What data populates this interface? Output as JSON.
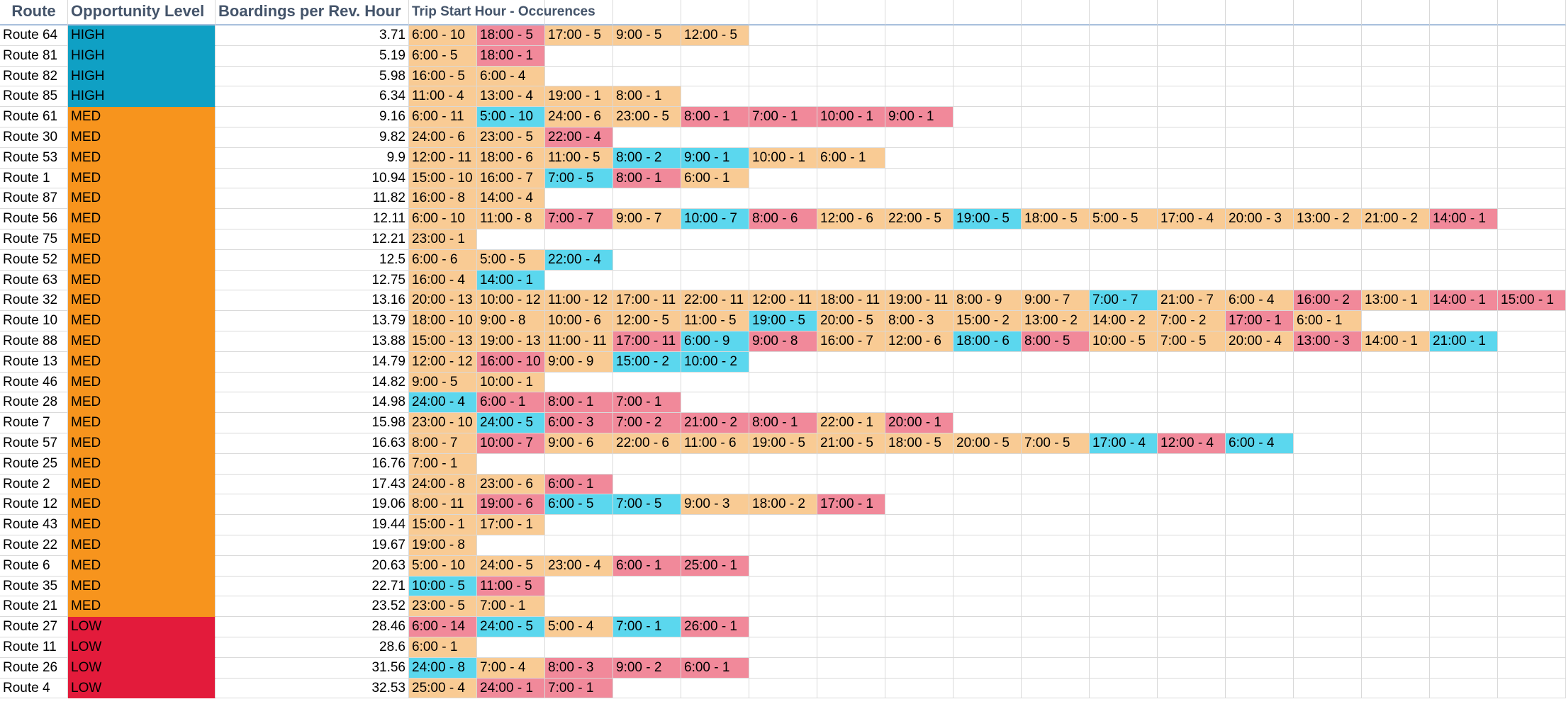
{
  "colors": {
    "peach": "#f9cb94",
    "pink": "#f1899a",
    "cyan": "#5bd7ee",
    "HIGH": "#0fa0c4",
    "MED": "#f7941d",
    "LOW": "#e31b3b",
    "header_text": "#44546a"
  },
  "headers": {
    "route": "Route",
    "level": "Opportunity Level",
    "boardings": "Boardings per Rev. Hour",
    "trips": "Trip Start Hour - Occurences"
  },
  "rows": [
    {
      "route": "Route 64",
      "level": "HIGH",
      "boardings": "3.71",
      "trips": [
        [
          "6:00 - 10",
          "peach"
        ],
        [
          "18:00 - 5",
          "pink"
        ],
        [
          "17:00 - 5",
          "peach"
        ],
        [
          "9:00 - 5",
          "peach"
        ],
        [
          "12:00 - 5",
          "peach"
        ]
      ]
    },
    {
      "route": "Route 81",
      "level": "HIGH",
      "boardings": "5.19",
      "trips": [
        [
          "6:00 - 5",
          "peach"
        ],
        [
          "18:00 - 1",
          "pink"
        ]
      ]
    },
    {
      "route": "Route 82",
      "level": "HIGH",
      "boardings": "5.98",
      "trips": [
        [
          "16:00 - 5",
          "peach"
        ],
        [
          "6:00 - 4",
          "peach"
        ]
      ]
    },
    {
      "route": "Route 85",
      "level": "HIGH",
      "boardings": "6.34",
      "trips": [
        [
          "11:00 - 4",
          "peach"
        ],
        [
          "13:00 - 4",
          "peach"
        ],
        [
          "19:00 - 1",
          "peach"
        ],
        [
          "8:00 - 1",
          "peach"
        ]
      ]
    },
    {
      "route": "Route 61",
      "level": "MED",
      "boardings": "9.16",
      "trips": [
        [
          "6:00 - 11",
          "peach"
        ],
        [
          "5:00 - 10",
          "cyan"
        ],
        [
          "24:00 - 6",
          "peach"
        ],
        [
          "23:00 - 5",
          "peach"
        ],
        [
          "8:00 - 1",
          "pink"
        ],
        [
          "7:00 - 1",
          "pink"
        ],
        [
          "10:00 - 1",
          "pink"
        ],
        [
          "9:00 - 1",
          "pink"
        ]
      ]
    },
    {
      "route": "Route 30",
      "level": "MED",
      "boardings": "9.82",
      "trips": [
        [
          "24:00 - 6",
          "peach"
        ],
        [
          "23:00 - 5",
          "peach"
        ],
        [
          "22:00 - 4",
          "pink"
        ]
      ]
    },
    {
      "route": "Route 53",
      "level": "MED",
      "boardings": "9.9",
      "trips": [
        [
          "12:00 - 11",
          "peach"
        ],
        [
          "18:00 - 6",
          "peach"
        ],
        [
          "11:00 - 5",
          "peach"
        ],
        [
          "8:00 - 2",
          "cyan"
        ],
        [
          "9:00 - 1",
          "cyan"
        ],
        [
          "10:00 - 1",
          "peach"
        ],
        [
          "6:00 - 1",
          "peach"
        ]
      ]
    },
    {
      "route": "Route 1",
      "level": "MED",
      "boardings": "10.94",
      "trips": [
        [
          "15:00 - 10",
          "peach"
        ],
        [
          "16:00 - 7",
          "peach"
        ],
        [
          "7:00 - 5",
          "cyan"
        ],
        [
          "8:00 - 1",
          "pink"
        ],
        [
          "6:00 - 1",
          "peach"
        ]
      ]
    },
    {
      "route": "Route 87",
      "level": "MED",
      "boardings": "11.82",
      "trips": [
        [
          "16:00 - 8",
          "peach"
        ],
        [
          "14:00 - 4",
          "peach"
        ]
      ]
    },
    {
      "route": "Route 56",
      "level": "MED",
      "boardings": "12.11",
      "trips": [
        [
          "6:00 - 10",
          "peach"
        ],
        [
          "11:00 - 8",
          "peach"
        ],
        [
          "7:00 - 7",
          "pink"
        ],
        [
          "9:00 - 7",
          "peach"
        ],
        [
          "10:00 - 7",
          "cyan"
        ],
        [
          "8:00 - 6",
          "pink"
        ],
        [
          "12:00 - 6",
          "peach"
        ],
        [
          "22:00 - 5",
          "peach"
        ],
        [
          "19:00 - 5",
          "cyan"
        ],
        [
          "18:00 - 5",
          "peach"
        ],
        [
          "5:00 - 5",
          "peach"
        ],
        [
          "17:00 - 4",
          "peach"
        ],
        [
          "20:00 - 3",
          "peach"
        ],
        [
          "13:00 - 2",
          "peach"
        ],
        [
          "21:00 - 2",
          "peach"
        ],
        [
          "14:00 - 1",
          "pink"
        ]
      ]
    },
    {
      "route": "Route 75",
      "level": "MED",
      "boardings": "12.21",
      "trips": [
        [
          "23:00 - 1",
          "peach"
        ]
      ]
    },
    {
      "route": "Route 52",
      "level": "MED",
      "boardings": "12.5",
      "trips": [
        [
          "6:00 - 6",
          "peach"
        ],
        [
          "5:00 - 5",
          "peach"
        ],
        [
          "22:00 - 4",
          "cyan"
        ]
      ]
    },
    {
      "route": "Route 63",
      "level": "MED",
      "boardings": "12.75",
      "trips": [
        [
          "16:00 - 4",
          "peach"
        ],
        [
          "14:00 - 1",
          "cyan"
        ]
      ]
    },
    {
      "route": "Route 32",
      "level": "MED",
      "boardings": "13.16",
      "trips": [
        [
          "20:00 - 13",
          "peach"
        ],
        [
          "10:00 - 12",
          "peach"
        ],
        [
          "11:00 - 12",
          "peach"
        ],
        [
          "17:00 - 11",
          "peach"
        ],
        [
          "22:00 - 11",
          "peach"
        ],
        [
          "12:00 - 11",
          "peach"
        ],
        [
          "18:00 - 11",
          "peach"
        ],
        [
          "19:00 - 11",
          "peach"
        ],
        [
          "8:00 - 9",
          "peach"
        ],
        [
          "9:00 - 7",
          "peach"
        ],
        [
          "7:00 - 7",
          "cyan"
        ],
        [
          "21:00 - 7",
          "peach"
        ],
        [
          "6:00 - 4",
          "peach"
        ],
        [
          "16:00 - 2",
          "pink"
        ],
        [
          "13:00 - 1",
          "peach"
        ],
        [
          "14:00 - 1",
          "pink"
        ],
        [
          "15:00 - 1",
          "pink"
        ]
      ]
    },
    {
      "route": "Route 10",
      "level": "MED",
      "boardings": "13.79",
      "trips": [
        [
          "18:00 - 10",
          "peach"
        ],
        [
          "9:00 - 8",
          "peach"
        ],
        [
          "10:00 - 6",
          "peach"
        ],
        [
          "12:00 - 5",
          "peach"
        ],
        [
          "11:00 - 5",
          "peach"
        ],
        [
          "19:00 - 5",
          "cyan"
        ],
        [
          "20:00 - 5",
          "peach"
        ],
        [
          "8:00 - 3",
          "peach"
        ],
        [
          "15:00 - 2",
          "peach"
        ],
        [
          "13:00 - 2",
          "peach"
        ],
        [
          "14:00 - 2",
          "peach"
        ],
        [
          "7:00 - 2",
          "peach"
        ],
        [
          "17:00 - 1",
          "pink"
        ],
        [
          "6:00 - 1",
          "peach"
        ]
      ]
    },
    {
      "route": "Route 88",
      "level": "MED",
      "boardings": "13.88",
      "trips": [
        [
          "15:00 - 13",
          "peach"
        ],
        [
          "19:00 - 13",
          "peach"
        ],
        [
          "11:00 - 11",
          "peach"
        ],
        [
          "17:00 - 11",
          "pink"
        ],
        [
          "6:00 - 9",
          "cyan"
        ],
        [
          "9:00 - 8",
          "pink"
        ],
        [
          "16:00 - 7",
          "peach"
        ],
        [
          "12:00 - 6",
          "peach"
        ],
        [
          "18:00 - 6",
          "cyan"
        ],
        [
          "8:00 - 5",
          "pink"
        ],
        [
          "10:00 - 5",
          "peach"
        ],
        [
          "7:00 - 5",
          "peach"
        ],
        [
          "20:00 - 4",
          "peach"
        ],
        [
          "13:00 - 3",
          "pink"
        ],
        [
          "14:00 - 1",
          "peach"
        ],
        [
          "21:00 - 1",
          "cyan"
        ]
      ]
    },
    {
      "route": "Route 13",
      "level": "MED",
      "boardings": "14.79",
      "trips": [
        [
          "12:00 - 12",
          "peach"
        ],
        [
          "16:00 - 10",
          "pink"
        ],
        [
          "9:00 - 9",
          "peach"
        ],
        [
          "15:00 - 2",
          "cyan"
        ],
        [
          "10:00 - 2",
          "cyan"
        ]
      ]
    },
    {
      "route": "Route 46",
      "level": "MED",
      "boardings": "14.82",
      "trips": [
        [
          "9:00 - 5",
          "peach"
        ],
        [
          "10:00 - 1",
          "peach"
        ]
      ]
    },
    {
      "route": "Route 28",
      "level": "MED",
      "boardings": "14.98",
      "trips": [
        [
          "24:00 - 4",
          "cyan"
        ],
        [
          "6:00 - 1",
          "pink"
        ],
        [
          "8:00 - 1",
          "pink"
        ],
        [
          "7:00 - 1",
          "pink"
        ]
      ]
    },
    {
      "route": "Route 7",
      "level": "MED",
      "boardings": "15.98",
      "trips": [
        [
          "23:00 - 10",
          "peach"
        ],
        [
          "24:00 - 5",
          "cyan"
        ],
        [
          "6:00 - 3",
          "pink"
        ],
        [
          "7:00 - 2",
          "pink"
        ],
        [
          "21:00 - 2",
          "pink"
        ],
        [
          "8:00 - 1",
          "pink"
        ],
        [
          "22:00 - 1",
          "peach"
        ],
        [
          "20:00 - 1",
          "pink"
        ]
      ]
    },
    {
      "route": "Route 57",
      "level": "MED",
      "boardings": "16.63",
      "trips": [
        [
          "8:00 - 7",
          "peach"
        ],
        [
          "10:00 - 7",
          "pink"
        ],
        [
          "9:00 - 6",
          "peach"
        ],
        [
          "22:00 - 6",
          "peach"
        ],
        [
          "11:00 - 6",
          "peach"
        ],
        [
          "19:00 - 5",
          "peach"
        ],
        [
          "21:00 - 5",
          "peach"
        ],
        [
          "18:00 - 5",
          "peach"
        ],
        [
          "20:00 - 5",
          "peach"
        ],
        [
          "7:00 - 5",
          "peach"
        ],
        [
          "17:00 - 4",
          "cyan"
        ],
        [
          "12:00 - 4",
          "pink"
        ],
        [
          "6:00 - 4",
          "cyan"
        ]
      ]
    },
    {
      "route": "Route 25",
      "level": "MED",
      "boardings": "16.76",
      "trips": [
        [
          "7:00 - 1",
          "peach"
        ]
      ]
    },
    {
      "route": "Route 2",
      "level": "MED",
      "boardings": "17.43",
      "trips": [
        [
          "24:00 - 8",
          "peach"
        ],
        [
          "23:00 - 6",
          "peach"
        ],
        [
          "6:00 - 1",
          "pink"
        ]
      ]
    },
    {
      "route": "Route 12",
      "level": "MED",
      "boardings": "19.06",
      "trips": [
        [
          "8:00 - 11",
          "peach"
        ],
        [
          "19:00 - 6",
          "pink"
        ],
        [
          "6:00 - 5",
          "cyan"
        ],
        [
          "7:00 - 5",
          "cyan"
        ],
        [
          "9:00 - 3",
          "peach"
        ],
        [
          "18:00 - 2",
          "peach"
        ],
        [
          "17:00 - 1",
          "pink"
        ]
      ]
    },
    {
      "route": "Route 43",
      "level": "MED",
      "boardings": "19.44",
      "trips": [
        [
          "15:00 - 1",
          "peach"
        ],
        [
          "17:00 - 1",
          "peach"
        ]
      ]
    },
    {
      "route": "Route 22",
      "level": "MED",
      "boardings": "19.67",
      "trips": [
        [
          "19:00 - 8",
          "peach"
        ]
      ]
    },
    {
      "route": "Route 6",
      "level": "MED",
      "boardings": "20.63",
      "trips": [
        [
          "5:00 - 10",
          "peach"
        ],
        [
          "24:00 - 5",
          "peach"
        ],
        [
          "23:00 - 4",
          "peach"
        ],
        [
          "6:00 - 1",
          "pink"
        ],
        [
          "25:00 - 1",
          "pink"
        ]
      ]
    },
    {
      "route": "Route 35",
      "level": "MED",
      "boardings": "22.71",
      "trips": [
        [
          "10:00 - 5",
          "cyan"
        ],
        [
          "11:00 - 5",
          "pink"
        ]
      ]
    },
    {
      "route": "Route 21",
      "level": "MED",
      "boardings": "23.52",
      "trips": [
        [
          "23:00 - 5",
          "peach"
        ],
        [
          "7:00 - 1",
          "peach"
        ]
      ]
    },
    {
      "route": "Route 27",
      "level": "LOW",
      "boardings": "28.46",
      "trips": [
        [
          "6:00 - 14",
          "pink"
        ],
        [
          "24:00 - 5",
          "cyan"
        ],
        [
          "5:00 - 4",
          "peach"
        ],
        [
          "7:00 - 1",
          "cyan"
        ],
        [
          "26:00 - 1",
          "pink"
        ]
      ]
    },
    {
      "route": "Route 11",
      "level": "LOW",
      "boardings": "28.6",
      "trips": [
        [
          "6:00 - 1",
          "peach"
        ]
      ]
    },
    {
      "route": "Route 26",
      "level": "LOW",
      "boardings": "31.56",
      "trips": [
        [
          "24:00 - 8",
          "cyan"
        ],
        [
          "7:00 - 4",
          "peach"
        ],
        [
          "8:00 - 3",
          "pink"
        ],
        [
          "9:00 - 2",
          "pink"
        ],
        [
          "6:00 - 1",
          "pink"
        ]
      ]
    },
    {
      "route": "Route 4",
      "level": "LOW",
      "boardings": "32.53",
      "trips": [
        [
          "25:00 - 4",
          "peach"
        ],
        [
          "24:00 - 1",
          "pink"
        ],
        [
          "7:00 - 1",
          "pink"
        ]
      ]
    }
  ]
}
